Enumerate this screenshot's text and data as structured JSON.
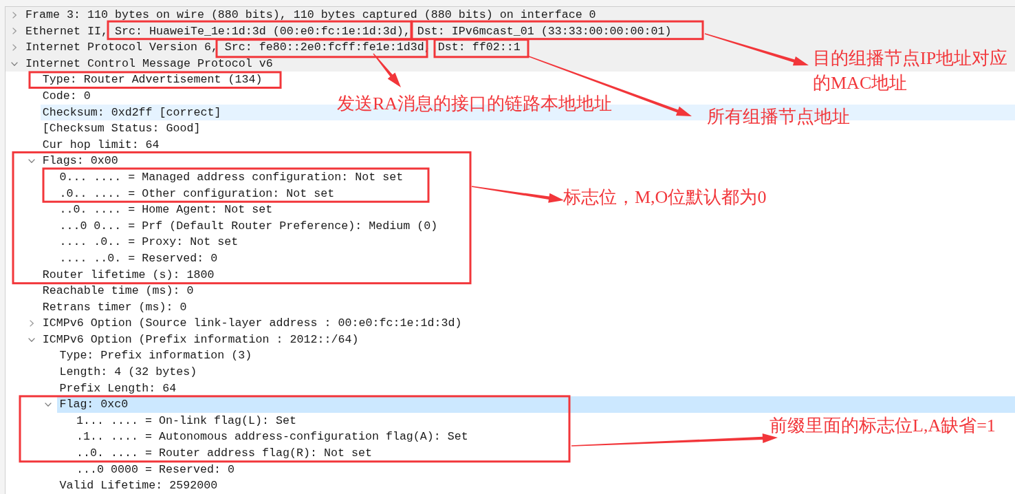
{
  "tree": [
    {
      "text": "Frame 3: 110 bytes on wire (880 bits), 110 bytes captured (880 bits) on interface 0",
      "expanded": false,
      "selected": false,
      "hovered": false
    },
    {
      "text": "Ethernet II, Src: HuaweiTe_1e:1d:3d (00:e0:fc:1e:1d:3d), Dst: IPv6mcast_01 (33:33:00:00:00:01)",
      "expanded": false,
      "selected": false,
      "hovered": false
    },
    {
      "text": "Internet Protocol Version 6, Src: fe80::2e0:fcff:fe1e:1d3d, Dst: ff02::1",
      "expanded": false,
      "selected": false,
      "hovered": false
    },
    {
      "text": "Internet Control Message Protocol v6",
      "expanded": true,
      "selected": false,
      "hovered": false,
      "children": [
        {
          "text": "Type: Router Advertisement (134)",
          "selected": false,
          "hovered": false
        },
        {
          "text": "Code: 0",
          "selected": false,
          "hovered": false
        },
        {
          "text": "Checksum: 0xd2ff [correct]",
          "selected": false,
          "hovered": true
        },
        {
          "text": "[Checksum Status: Good]",
          "selected": false,
          "hovered": false
        },
        {
          "text": "Cur hop limit: 64",
          "selected": false,
          "hovered": false
        },
        {
          "text": "Flags: 0x00",
          "expanded": true,
          "selected": false,
          "hovered": false,
          "children": [
            {
              "text": "0... .... = Managed address configuration: Not set",
              "selected": false,
              "hovered": false
            },
            {
              "text": ".0.. .... = Other configuration: Not set",
              "selected": false,
              "hovered": false
            },
            {
              "text": "..0. .... = Home Agent: Not set",
              "selected": false,
              "hovered": false
            },
            {
              "text": "...0 0... = Prf (Default Router Preference): Medium (0)",
              "selected": false,
              "hovered": false
            },
            {
              "text": ".... .0.. = Proxy: Not set",
              "selected": false,
              "hovered": false
            },
            {
              "text": ".... ..0. = Reserved: 0",
              "selected": false,
              "hovered": false
            }
          ]
        },
        {
          "text": "Router lifetime (s): 1800",
          "selected": false,
          "hovered": false
        },
        {
          "text": "Reachable time (ms): 0",
          "selected": false,
          "hovered": false
        },
        {
          "text": "Retrans timer (ms): 0",
          "selected": false,
          "hovered": false
        },
        {
          "text": "ICMPv6 Option (Source link-layer address : 00:e0:fc:1e:1d:3d)",
          "expanded": false,
          "selected": false,
          "hovered": false
        },
        {
          "text": "ICMPv6 Option (Prefix information : 2012::/64)",
          "expanded": true,
          "selected": false,
          "hovered": false,
          "children": [
            {
              "text": "Type: Prefix information (3)",
              "selected": false,
              "hovered": false
            },
            {
              "text": "Length: 4 (32 bytes)",
              "selected": false,
              "hovered": false
            },
            {
              "text": "Prefix Length: 64",
              "selected": false,
              "hovered": false
            },
            {
              "text": "Flag: 0xc0",
              "expanded": true,
              "selected": true,
              "hovered": false,
              "children": [
                {
                  "text": "1... .... = On-link flag(L): Set",
                  "selected": false,
                  "hovered": false
                },
                {
                  "text": ".1.. .... = Autonomous address-configuration flag(A): Set",
                  "selected": false,
                  "hovered": false
                },
                {
                  "text": "..0. .... = Router address flag(R): Not set",
                  "selected": false,
                  "hovered": false
                },
                {
                  "text": "...0 0000 = Reserved: 0",
                  "selected": false,
                  "hovered": false
                }
              ]
            },
            {
              "text": "Valid Lifetime: 2592000",
              "selected": false,
              "hovered": false
            }
          ]
        }
      ]
    }
  ],
  "annotations": [
    {
      "text": "目的组播节点IP地址对应的MAC地址"
    },
    {
      "text": "发送RA消息的接口的链路本地地址"
    },
    {
      "text": "所有组播节点地址"
    },
    {
      "text": "标志位，M,O位默认都为0"
    },
    {
      "text": "前缀里面的标志位L,A缺省=1"
    }
  ]
}
